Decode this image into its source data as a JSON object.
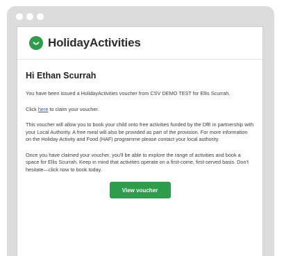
{
  "brand": {
    "name": "HolidayActivities",
    "accent_color": "#2e9d4b"
  },
  "email": {
    "greeting": "Hi Ethan Scurrah",
    "p1": "You have been issued a HolidayActivities voucher from CSV DEMO TEST for Ellis Scurrah.",
    "p2_before": "Click ",
    "p2_link": "here",
    "p2_after": " to claim your voucher.",
    "p3": "This voucher will allow you to book your child onto free activities funded by the DfE in partnership with your Local Authority. A free meal will also be provided as part of the provision. For more information on the Holiday Activity and Food (HAF) programme please contact your local authority.",
    "p4": "Once you have claimed your voucher, you'll be able to explore the range of activities and book a space for Ellis Scurrah. Keep in mind that activities operate on a first-come, first-served basis. Don't hesitate—click now to book today.",
    "button_label": "View voucher"
  },
  "icons": {
    "logo": "smile-logo-icon"
  }
}
